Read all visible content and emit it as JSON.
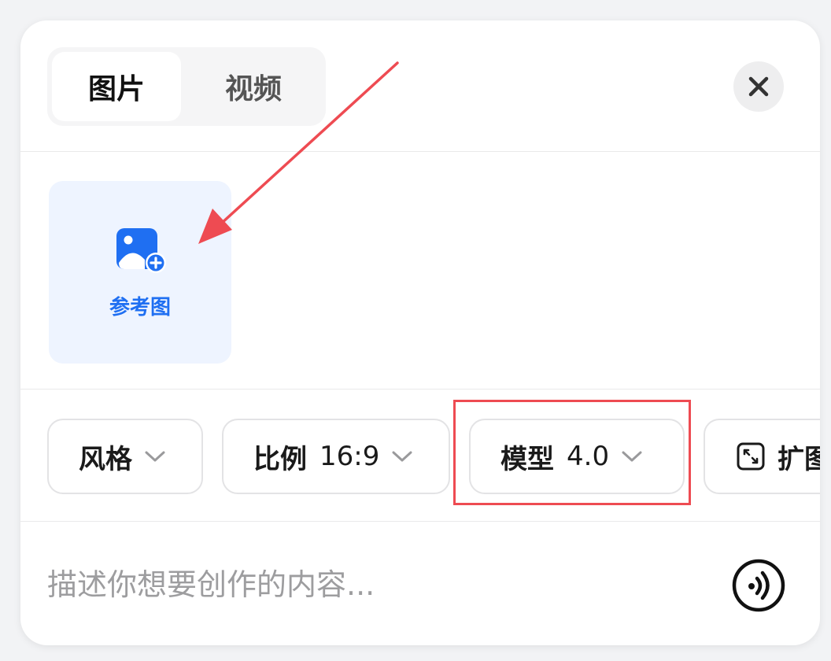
{
  "tabs": [
    {
      "label": "图片",
      "active": true
    },
    {
      "label": "视频",
      "active": false
    }
  ],
  "reference": {
    "label": "参考图"
  },
  "options": {
    "style": {
      "label": "风格"
    },
    "ratio": {
      "label": "比例",
      "value": "16:9"
    },
    "model": {
      "label": "模型",
      "value": "4.0"
    },
    "expand": {
      "label": "扩图"
    }
  },
  "prompt": {
    "placeholder": "描述你想要创作的内容..."
  },
  "icons": {
    "close": "close-icon",
    "reference": "add-image-icon",
    "chevron": "chevron-down-icon",
    "expand": "expand-icon",
    "voice": "voice-icon"
  },
  "colors": {
    "accent": "#1f6ff2",
    "annotation": "#ee4b52"
  }
}
